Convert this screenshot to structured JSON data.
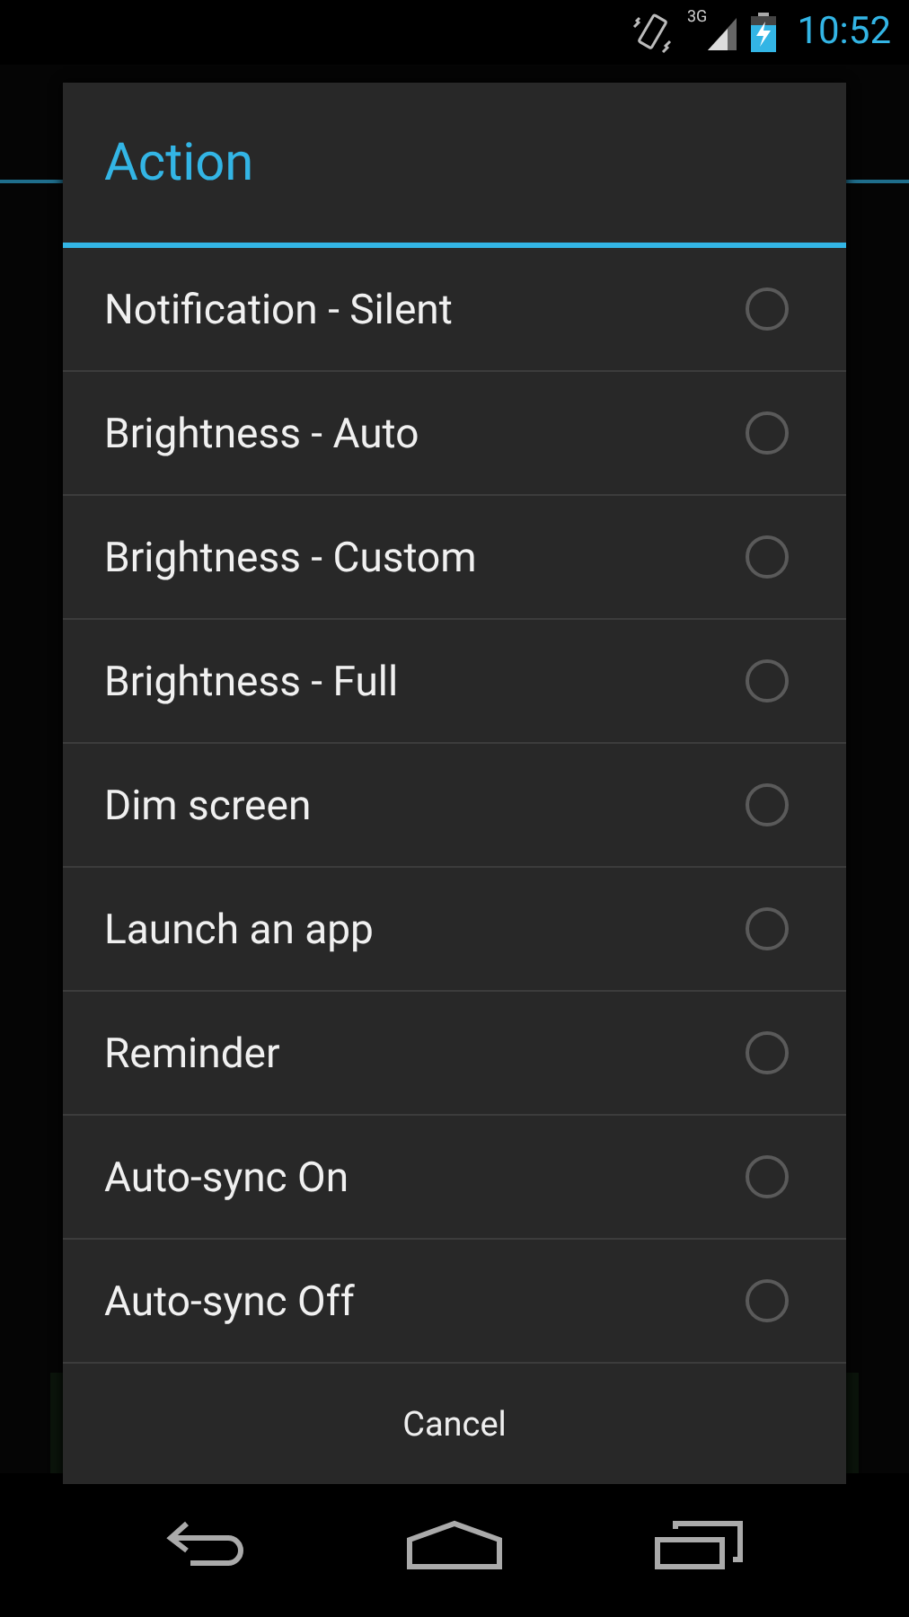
{
  "status_bar": {
    "network": "3G",
    "time": "10:52"
  },
  "dialog": {
    "title": "Action",
    "options": [
      {
        "label": "Notification - Silent",
        "selected": false
      },
      {
        "label": "Brightness - Auto",
        "selected": false
      },
      {
        "label": "Brightness - Custom",
        "selected": false
      },
      {
        "label": "Brightness - Full",
        "selected": false
      },
      {
        "label": "Dim screen",
        "selected": false
      },
      {
        "label": "Launch an app",
        "selected": false
      },
      {
        "label": "Reminder",
        "selected": false
      },
      {
        "label": "Auto-sync On",
        "selected": false
      },
      {
        "label": "Auto-sync Off",
        "selected": false
      }
    ],
    "button": "Cancel"
  }
}
